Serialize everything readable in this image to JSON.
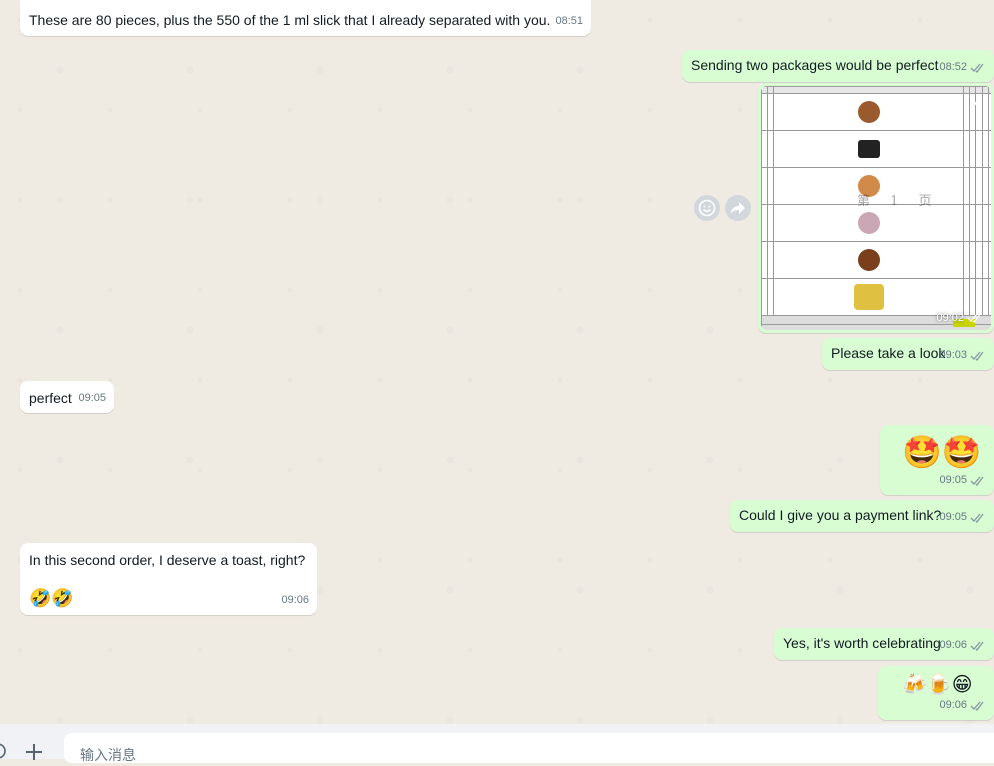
{
  "messages": {
    "m1": {
      "text": "These are 80 pieces, plus the 550 of the 1 ml slick that I already separated with you.",
      "time": "08:51"
    },
    "m2": {
      "text": "Sending two packages would be perfect",
      "time": "08:52"
    },
    "m3": {
      "time": "09:02",
      "watermark": "第 1 页"
    },
    "m4": {
      "text": "Please take a look",
      "time": "09:03"
    },
    "m5": {
      "text": "perfect",
      "time": "09:05"
    },
    "m6": {
      "emoji": "🤩🤩",
      "time": "09:05"
    },
    "m7": {
      "text": "Could I give you a payment link?",
      "time": "09:05"
    },
    "m8": {
      "text": "In this second order, I deserve a toast, right?",
      "emoji": "🤣🤣",
      "time": "09:06"
    },
    "m9": {
      "text": "Yes, it's worth celebrating",
      "time": "09:06"
    },
    "m10": {
      "emoji": "🍻🍺😁",
      "time": "09:06"
    }
  },
  "composer": {
    "placeholder": "输入消息"
  },
  "icons": {
    "react": "emoji-reaction-icon",
    "forward": "forward-icon",
    "plus": "plus-icon",
    "chevron": "chevron-down-icon",
    "ticks": "double-check-icon"
  },
  "colors": {
    "incoming": "#ffffff",
    "outgoing": "#d9fdd3",
    "background": "#efeae2",
    "meta": "#667781"
  }
}
